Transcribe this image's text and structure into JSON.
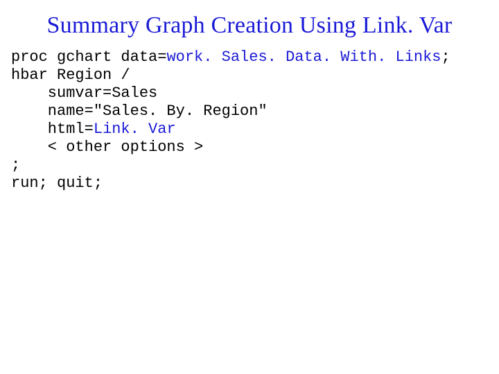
{
  "title": "Summary Graph Creation Using Link. Var",
  "code": {
    "l1a": "proc gchart data=",
    "l1b": "work. Sales. Data. With. Links",
    "l1c": ";",
    "l2": "hbar Region /",
    "l3": "    sumvar=Sales",
    "l4": "    name=\"Sales. By. Region\"",
    "l5a": "    html=",
    "l5b": "Link. Var",
    "l6": "    < other options >",
    "l7": ";",
    "l8": "run; quit;"
  }
}
